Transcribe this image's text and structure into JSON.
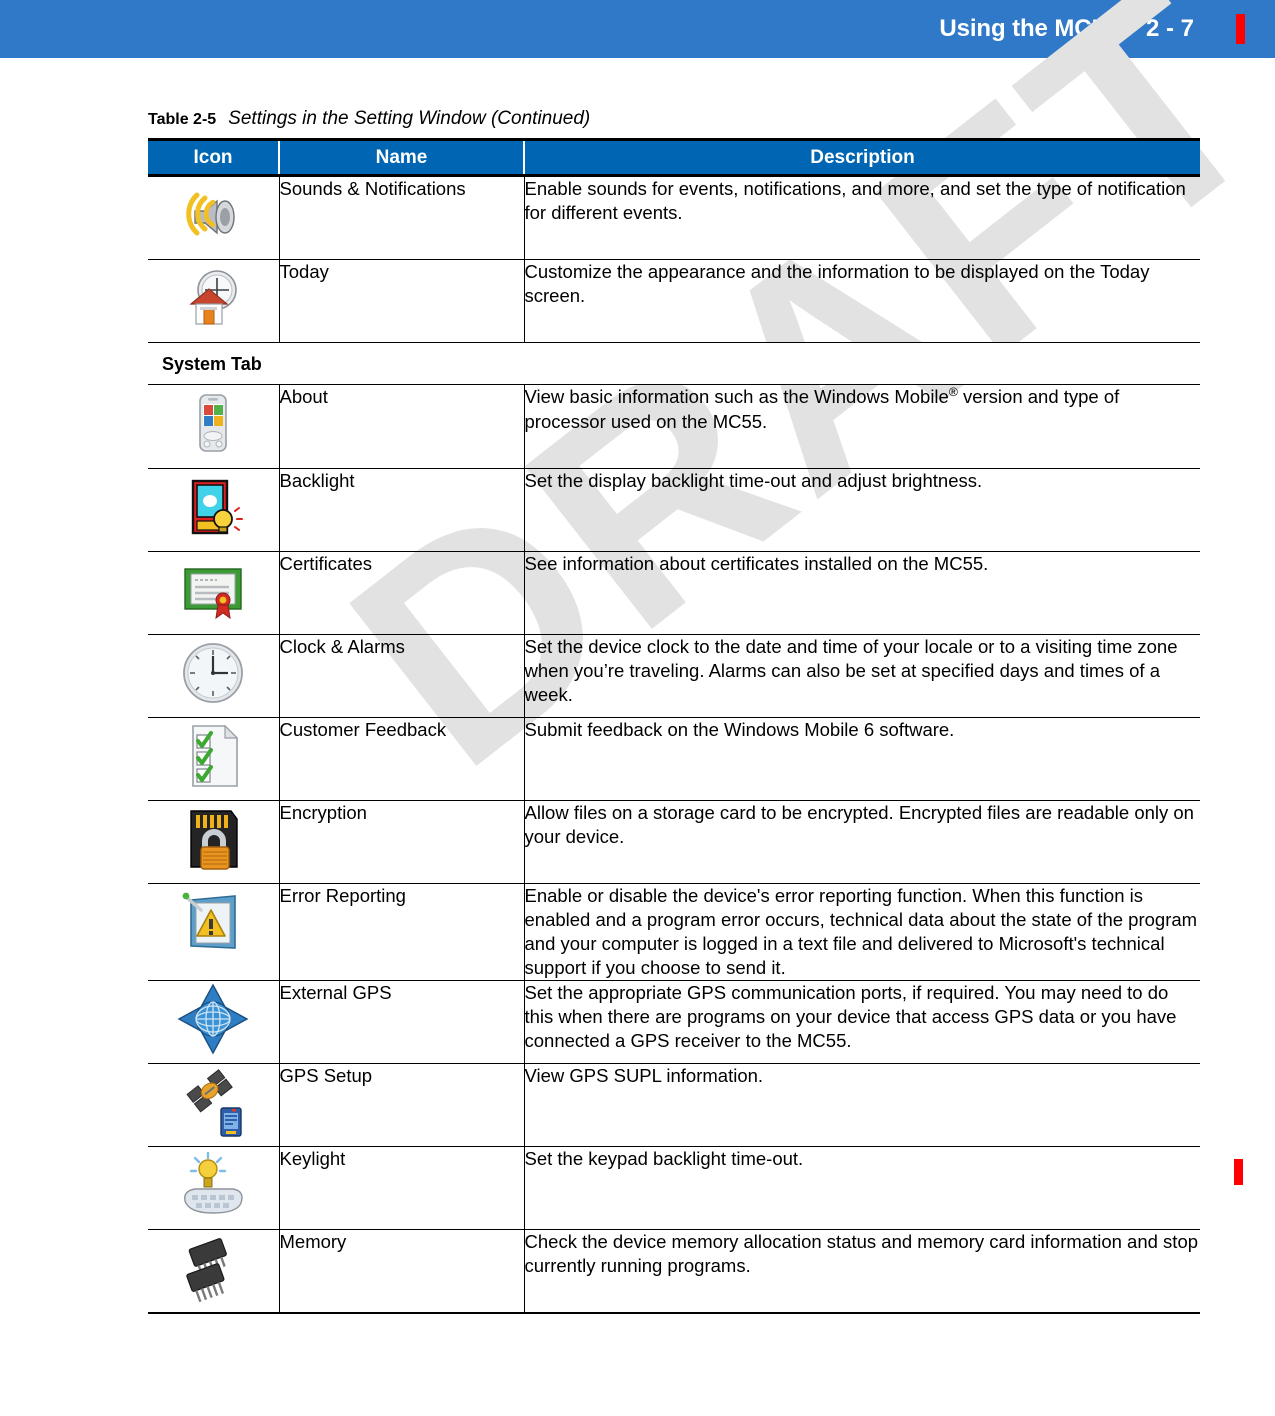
{
  "header": {
    "title": "Using the MC55",
    "page_number": "2 - 7",
    "band_color": "#3079c8",
    "marker_color": "#ff0000"
  },
  "watermark": {
    "text": "DRAFT",
    "color": "#e2e2e2"
  },
  "table": {
    "caption_label": "Table 2-5",
    "caption_title": "Settings in the Setting Window (Continued)",
    "header_color": "#0066b3",
    "columns": [
      "Icon",
      "Name",
      "Description"
    ],
    "rows": [
      {
        "icon": "sounds-notifications-icon",
        "name": "Sounds & Notifications",
        "description": "Enable sounds for events, notifications, and more, and set the type of notification for different events."
      },
      {
        "icon": "today-icon",
        "name": "Today",
        "description": "Customize the appearance and the information to be displayed on the Today screen."
      }
    ],
    "section_heading": "System Tab",
    "system_rows": [
      {
        "icon": "about-device-icon",
        "name": "About",
        "description_pre": "View basic information such as the Windows Mobile",
        "description_sup": "®",
        "description_post": " version and type of processor used on the MC55."
      },
      {
        "icon": "backlight-icon",
        "name": "Backlight",
        "description": "Set the display backlight time-out and adjust brightness."
      },
      {
        "icon": "certificates-icon",
        "name": "Certificates",
        "description": "See information about certificates installed on the MC55."
      },
      {
        "icon": "clock-alarms-icon",
        "name": "Clock & Alarms",
        "description": "Set the device clock to the date and time of your locale or to a visiting time zone when you’re traveling. Alarms can also be set at specified days and times of a week."
      },
      {
        "icon": "customer-feedback-icon",
        "name": "Customer Feedback",
        "description": "Submit feedback on the Windows Mobile 6 software."
      },
      {
        "icon": "encryption-icon",
        "name": "Encryption",
        "description": "Allow files on a storage card to be encrypted. Encrypted files are readable only on your device."
      },
      {
        "icon": "error-reporting-icon",
        "name": "Error Reporting",
        "description": "Enable or disable the device's error reporting function. When this function is enabled and a program error occurs, technical data about the state of the program and your computer is logged in a text file and delivered to Microsoft's technical support if you choose to send it."
      },
      {
        "icon": "external-gps-icon",
        "name": "External GPS",
        "description": "Set the appropriate GPS communication ports, if required. You may need to do this when there are programs on your device that access GPS data or you have connected a GPS receiver to the MC55."
      },
      {
        "icon": "gps-setup-icon",
        "name": "GPS Setup",
        "description": "View GPS SUPL information."
      },
      {
        "icon": "keylight-icon",
        "name": "Keylight",
        "description": "Set the keypad backlight time-out."
      },
      {
        "icon": "memory-icon",
        "name": "Memory",
        "description": "Check the device memory allocation status and memory card information and stop currently running programs."
      }
    ]
  }
}
